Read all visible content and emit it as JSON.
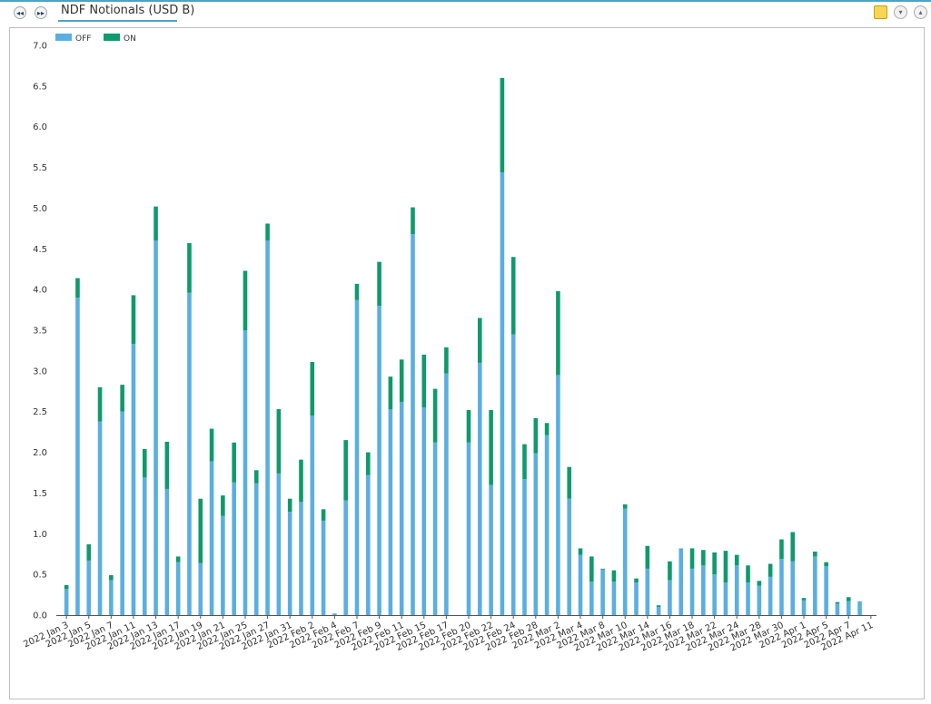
{
  "header": {
    "title": "NDF Notionals (USD B)",
    "prev_label": "◂◂",
    "next_label": "▸▸",
    "collapse_label": "▾",
    "expand_label": "▴"
  },
  "colors": {
    "off": "#5aafe0",
    "on": "#0e9a6c",
    "accent": "#4aa3c8"
  },
  "chart_data": {
    "type": "bar",
    "stacked": true,
    "title": "",
    "xlabel": "",
    "ylabel": "",
    "ylim": [
      0,
      7
    ],
    "yticks": [
      0.0,
      0.5,
      1.0,
      1.5,
      2.0,
      2.5,
      3.0,
      3.5,
      4.0,
      4.5,
      5.0,
      5.5,
      6.0,
      6.5,
      7.0
    ],
    "ytick_labels": [
      "0.0",
      "0.5",
      "1.0",
      "1.5",
      "2.0",
      "2.5",
      "3.0",
      "3.5",
      "4.0",
      "4.5",
      "5.0",
      "5.5",
      "6.0",
      "6.5",
      "7.0"
    ],
    "legend": {
      "position": "top-left",
      "entries": [
        "OFF",
        "ON"
      ]
    },
    "grid": false,
    "categories": [
      "2022 Jan 3",
      "2022 Jan 4",
      "2022 Jan 5",
      "2022 Jan 6",
      "2022 Jan 7",
      "2022 Jan 10",
      "2022 Jan 11",
      "2022 Jan 12",
      "2022 Jan 13",
      "2022 Jan 14",
      "2022 Jan 17",
      "2022 Jan 18",
      "2022 Jan 19",
      "2022 Jan 20",
      "2022 Jan 21",
      "2022 Jan 24",
      "2022 Jan 25",
      "2022 Jan 26",
      "2022 Jan 27",
      "2022 Jan 28",
      "2022 Jan 31",
      "2022 Feb 1",
      "2022 Feb 2",
      "2022 Feb 3",
      "2022 Feb 4",
      "2022 Feb 5",
      "2022 Feb 7",
      "2022 Feb 8",
      "2022 Feb 9",
      "2022 Feb 10",
      "2022 Feb 11",
      "2022 Feb 14",
      "2022 Feb 15",
      "2022 Feb 16",
      "2022 Feb 17",
      "2022 Feb 18",
      "2022 Feb 20",
      "2022 Feb 21",
      "2022 Feb 22",
      "2022 Feb 23",
      "2022 Feb 24",
      "2022 Feb 25",
      "2022 Feb 28",
      "2022 Mar 1",
      "2022 Mar 2",
      "2022 Mar 3",
      "2022 Mar 4",
      "2022 Mar 7",
      "2022 Mar 8",
      "2022 Mar 9",
      "2022 Mar 10",
      "2022 Mar 11",
      "2022 Mar 14",
      "2022 Mar 15",
      "2022 Mar 16",
      "2022 Mar 17",
      "2022 Mar 18",
      "2022 Mar 21",
      "2022 Mar 22",
      "2022 Mar 23",
      "2022 Mar 24",
      "2022 Mar 25",
      "2022 Mar 28",
      "2022 Mar 29",
      "2022 Mar 30",
      "2022 Mar 31",
      "2022 Apr 1",
      "2022 Apr 4",
      "2022 Apr 5",
      "2022 Apr 6",
      "2022 Apr 7",
      "2022 Apr 8",
      "2022 Apr 11"
    ],
    "x_tick_labels": [
      "2022 Jan 3",
      "2022 Jan 5",
      "2022 Jan 7",
      "2022 Jan 11",
      "2022 Jan 13",
      "2022 Jan 17",
      "2022 Jan 19",
      "2022 Jan 21",
      "2022 Jan 25",
      "2022 Jan 27",
      "2022 Jan 31",
      "2022 Feb 2",
      "2022 Feb 4",
      "2022 Feb 7",
      "2022 Feb 9",
      "2022 Feb 11",
      "2022 Feb 15",
      "2022 Feb 17",
      "2022 Feb 20",
      "2022 Feb 22",
      "2022 Feb 24",
      "2022 Feb 28",
      "2022 Mar 2",
      "2022 Mar 4",
      "2022 Mar 8",
      "2022 Mar 10",
      "2022 Mar 14",
      "2022 Mar 16",
      "2022 Mar 18",
      "2022 Mar 22",
      "2022 Mar 24",
      "2022 Mar 28",
      "2022 Mar 30",
      "2022 Apr 1",
      "2022 Apr 5",
      "2022 Apr 7",
      "2022 Apr 11"
    ],
    "series": [
      {
        "name": "OFF",
        "values": [
          0.32,
          3.9,
          0.67,
          2.38,
          0.43,
          2.5,
          3.33,
          1.69,
          4.6,
          1.55,
          0.65,
          3.96,
          0.64,
          1.89,
          1.22,
          1.63,
          3.5,
          1.62,
          4.6,
          1.74,
          1.27,
          1.39,
          2.45,
          1.16,
          0.02,
          1.41,
          3.87,
          1.72,
          3.8,
          2.53,
          2.62,
          4.68,
          2.55,
          2.12,
          2.97,
          0.0,
          2.12,
          3.1,
          1.6,
          5.44,
          3.45,
          1.67,
          1.99,
          2.21,
          2.95,
          1.43,
          0.74,
          0.41,
          0.56,
          0.41,
          1.31,
          0.4,
          0.57,
          0.1,
          0.43,
          0.82,
          0.57,
          0.61,
          0.5,
          0.4,
          0.61,
          0.4,
          0.36,
          0.47,
          0.69,
          0.66,
          0.18,
          0.72,
          0.6,
          0.14,
          0.17,
          0.17
        ]
      },
      {
        "name": "ON",
        "values": [
          0.05,
          0.24,
          0.2,
          0.42,
          0.06,
          0.33,
          0.6,
          0.35,
          0.42,
          0.58,
          0.07,
          0.61,
          0.79,
          0.4,
          0.25,
          0.49,
          0.73,
          0.16,
          0.21,
          0.79,
          0.16,
          0.52,
          0.66,
          0.14,
          0.0,
          0.74,
          0.2,
          0.28,
          0.54,
          0.4,
          0.52,
          0.33,
          0.65,
          0.66,
          0.32,
          0.0,
          0.4,
          0.55,
          0.92,
          1.16,
          0.95,
          0.43,
          0.43,
          0.15,
          1.03,
          0.39,
          0.08,
          0.31,
          0.01,
          0.14,
          0.05,
          0.05,
          0.28,
          0.02,
          0.23,
          0.0,
          0.25,
          0.19,
          0.27,
          0.39,
          0.13,
          0.21,
          0.06,
          0.16,
          0.24,
          0.36,
          0.03,
          0.06,
          0.05,
          0.02,
          0.05,
          0.0
        ]
      }
    ]
  }
}
